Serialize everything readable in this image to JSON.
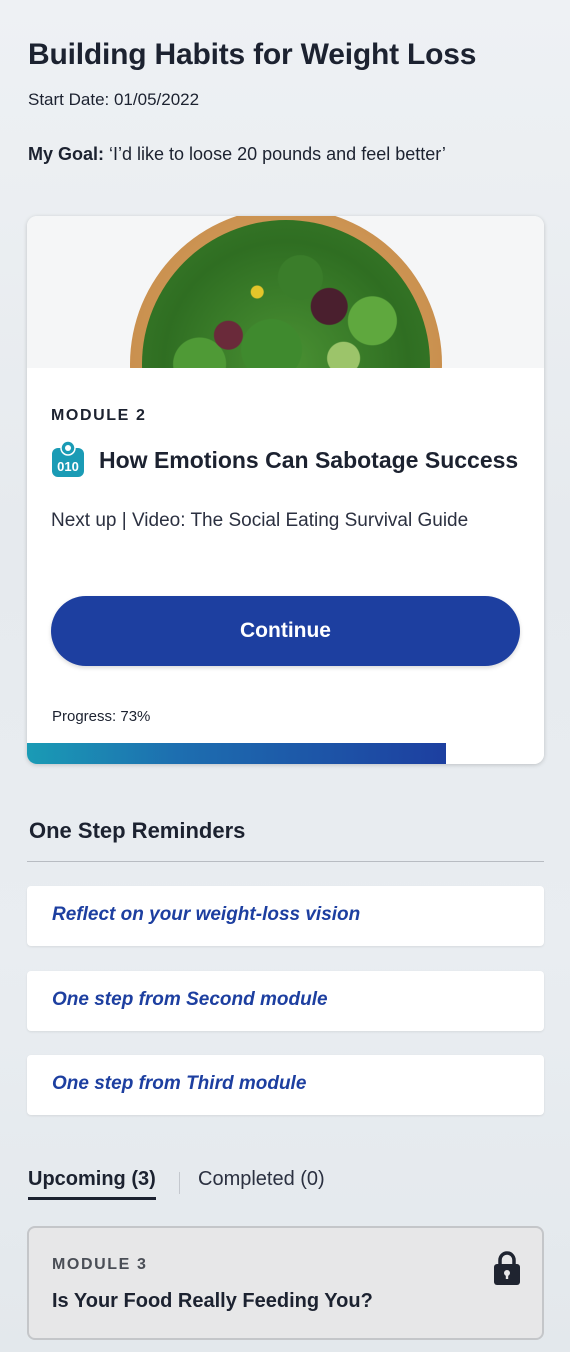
{
  "header": {
    "title": "Building Habits for Weight Loss",
    "start_date": "Start Date: 01/05/2022",
    "goal_label": "My Goal:",
    "goal_text": " ‘I’d like to loose 20 pounds and feel better’"
  },
  "current_module": {
    "hero_image": "salad-bowl-image",
    "module_label": "MODULE 2",
    "icon": "scale-icon",
    "title": "How Emotions Can Sabotage Success",
    "next_up": "Next up | Video: The Social Eating Survival Guide",
    "continue_label": "Continue",
    "progress_text": "Progress: 73%",
    "progress_value": 0.81,
    "accent_color": "#1d3fa0"
  },
  "reminders": {
    "heading": "One Step Reminders",
    "items": [
      {
        "label": "Reflect on your weight-loss vision"
      },
      {
        "label": "One step from Second module"
      },
      {
        "label": "One step from Third module"
      }
    ]
  },
  "tabs": {
    "upcoming": "Upcoming (3)",
    "completed": "Completed (0)",
    "active": "upcoming"
  },
  "upcoming": [
    {
      "module_label": "MODULE 3",
      "title": "Is Your Food Really Feeding You?",
      "icon": "lock-icon"
    }
  ]
}
